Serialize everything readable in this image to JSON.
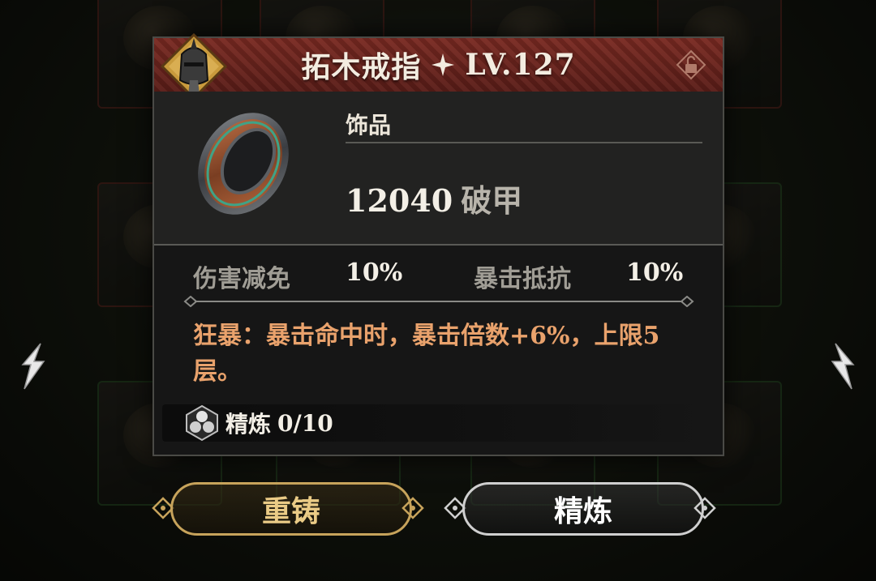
{
  "colors": {
    "title_bar": "#6a2420",
    "effect_text": "#e9a26c",
    "reforge_border": "#c7a35b",
    "refine_border": "#cfcfcf"
  },
  "item": {
    "name": "拓木戒指",
    "level": "LV.127",
    "category": "饰品",
    "main_stat_value": "12040",
    "main_stat_name": "破甲",
    "substats": [
      {
        "name": "伤害减免",
        "value": "10%"
      },
      {
        "name": "暴击抵抗",
        "value": "10%"
      }
    ],
    "effect_text": "狂暴：暴击命中时，暴击倍数+6%，上限5层。",
    "refine_label": "精炼",
    "refine_progress": "0/10",
    "icons": {
      "hero": "knight-helmet-icon",
      "star": "four-point-star-icon",
      "lock": "unlocked-padlock-icon",
      "refine": "refine-crystal-icon"
    }
  },
  "buttons": {
    "reforge": "重铸",
    "refine": "精炼"
  }
}
